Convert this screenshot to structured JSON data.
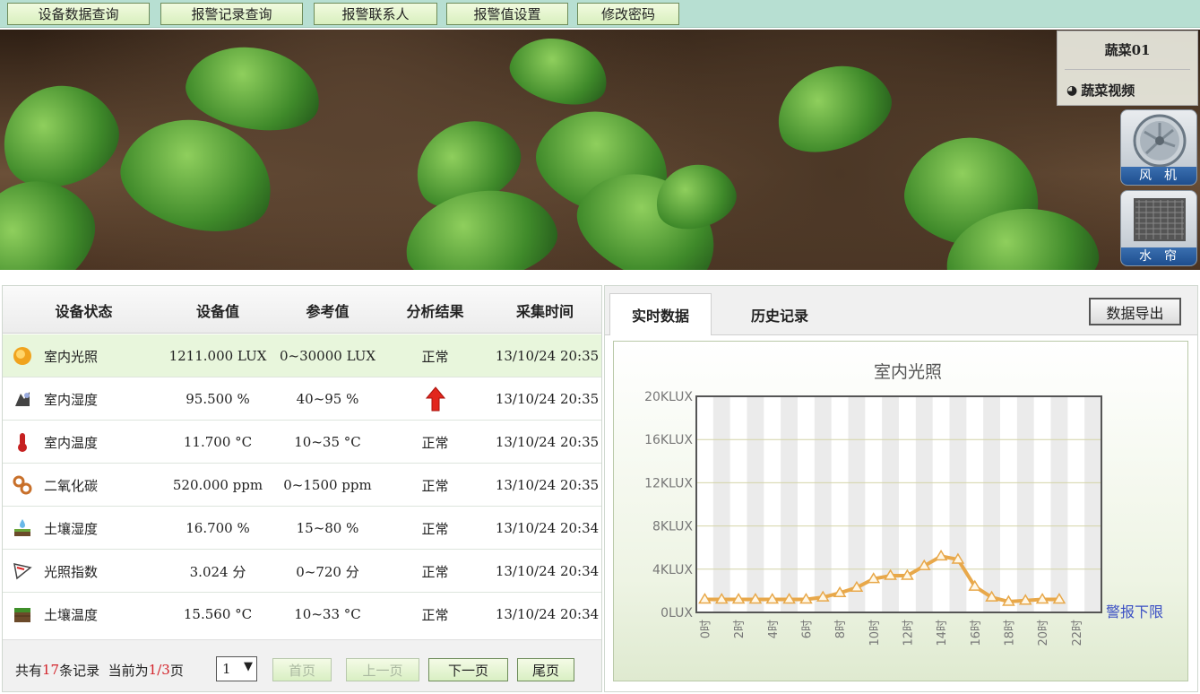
{
  "nav": {
    "items": [
      "设备数据查询",
      "报警记录查询",
      "报警联系人",
      "报警值设置",
      "修改密码"
    ]
  },
  "side": {
    "title": "蔬菜01",
    "video_label": "蔬菜视频",
    "fan_label": "风机",
    "curtain_label": "水帘"
  },
  "table": {
    "headers": [
      "设备状态",
      "设备值",
      "参考值",
      "分析结果",
      "采集时间"
    ],
    "rows": [
      {
        "icon": "sun-icon",
        "name": "室内光照",
        "value": "1211.000 LUX",
        "ref": "0~30000 LUX",
        "result": "正常",
        "time": "13/10/24 20:35"
      },
      {
        "icon": "humidity-icon",
        "name": "室内湿度",
        "value": "95.500 %",
        "ref": "40~95 %",
        "result": "",
        "result_icon": "up-arrow-icon",
        "time": "13/10/24 20:35"
      },
      {
        "icon": "thermometer-icon",
        "name": "室内温度",
        "value": "11.700 °C",
        "ref": "10~35 °C",
        "result": "正常",
        "time": "13/10/24 20:35"
      },
      {
        "icon": "co2-icon",
        "name": "二氧化碳",
        "value": "520.000 ppm",
        "ref": "0~1500 ppm",
        "result": "正常",
        "time": "13/10/24 20:35"
      },
      {
        "icon": "soil-moisture-icon",
        "name": "土壤湿度",
        "value": "16.700 %",
        "ref": "15~80 %",
        "result": "正常",
        "time": "13/10/24 20:34"
      },
      {
        "icon": "light-index-icon",
        "name": "光照指数",
        "value": "3.024 分",
        "ref": "0~720 分",
        "result": "正常",
        "time": "13/10/24 20:34"
      },
      {
        "icon": "soil-temp-icon",
        "name": "土壤温度",
        "value": "15.560 °C",
        "ref": "10~33 °C",
        "result": "正常",
        "time": "13/10/24 20:34"
      }
    ]
  },
  "pager": {
    "prefix": "共有",
    "total": "17",
    "mid": "条记录  当前为",
    "current": "1",
    "slash": "/",
    "pages": "3",
    "suffix": "页",
    "select_value": "1",
    "first": "首页",
    "prev": "上一页",
    "next": "下一页",
    "last": "尾页"
  },
  "tabs": {
    "realtime": "实时数据",
    "history": "历史记录",
    "export": "数据导出"
  },
  "chart_data": {
    "type": "line",
    "title": "室内光照",
    "x": [
      "0时",
      "1时",
      "2时",
      "3时",
      "4时",
      "5时",
      "6时",
      "7时",
      "8时",
      "9时",
      "10时",
      "11时",
      "12时",
      "13时",
      "14时",
      "15时",
      "16时",
      "17时",
      "18时",
      "19时",
      "20时",
      "21时"
    ],
    "x_tick_labels": [
      "0时",
      "2时",
      "4时",
      "6时",
      "8时",
      "10时",
      "12时",
      "14时",
      "16时",
      "18时",
      "20时",
      "22时"
    ],
    "series": [
      {
        "values": [
          1.2,
          1.2,
          1.2,
          1.2,
          1.2,
          1.2,
          1.2,
          1.4,
          1.8,
          2.3,
          3.1,
          3.4,
          3.4,
          4.3,
          5.2,
          4.9,
          2.4,
          1.4,
          1.0,
          1.1,
          1.2,
          1.2
        ],
        "color": "#e8a84a"
      }
    ],
    "y_ticks": [
      "0LUX",
      "4KLUX",
      "8KLUX",
      "12KLUX",
      "16KLUX",
      "20KLUX"
    ],
    "ylim": [
      0,
      20
    ],
    "grid": true,
    "side_label": "警报下限",
    "side_label_color": "#3a4fc4"
  }
}
